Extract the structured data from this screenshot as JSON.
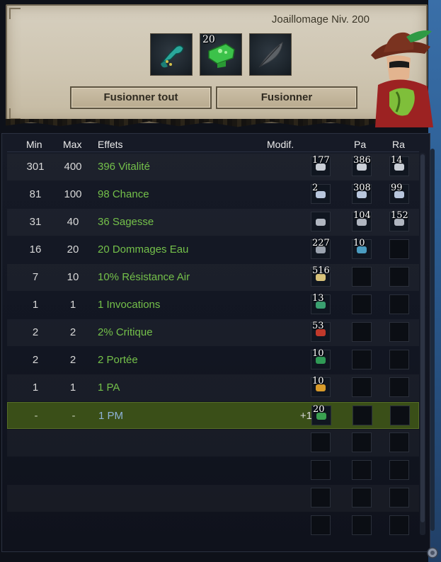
{
  "window": {
    "job_title": "Joaillomage Niv. 200"
  },
  "slots": {
    "rune": {
      "icon": "teal-rune-icon"
    },
    "item": {
      "icon": "green-item-icon",
      "count": "20"
    },
    "feather": {
      "icon": "feather-icon"
    }
  },
  "buttons": {
    "fuse_all": "Fusionner tout",
    "fuse": "Fusionner"
  },
  "table": {
    "headers": {
      "min": "Min",
      "max": "Max",
      "effects": "Effets",
      "modif": "Modif.",
      "pa": "Pa",
      "ra": "Ra"
    },
    "rows": [
      {
        "min": "301",
        "max": "400",
        "effect": "396 Vitalité",
        "modif": "",
        "runes": [
          {
            "count": "177",
            "color": "#c9ced6"
          },
          {
            "count": "386",
            "color": "#c9ced6"
          },
          {
            "count": "14",
            "color": "#c9ced6"
          }
        ]
      },
      {
        "min": "81",
        "max": "100",
        "effect": "98 Chance",
        "modif": "",
        "runes": [
          {
            "count": "2",
            "color": "#b8c6dc"
          },
          {
            "count": "308",
            "color": "#b8c6dc"
          },
          {
            "count": "99",
            "color": "#b8c6dc"
          }
        ]
      },
      {
        "min": "31",
        "max": "40",
        "effect": "36 Sagesse",
        "modif": "",
        "runes": [
          {
            "count": "",
            "color": "#b0b6c0"
          },
          {
            "count": "104",
            "color": "#b0b6c0"
          },
          {
            "count": "152",
            "color": "#b0b6c0"
          }
        ]
      },
      {
        "min": "16",
        "max": "20",
        "effect": "20 Dommages Eau",
        "modif": "",
        "runes": [
          {
            "count": "227",
            "color": "#9aa2ae"
          },
          {
            "count": "10",
            "color": "#4a9cc0"
          },
          null
        ]
      },
      {
        "min": "7",
        "max": "10",
        "effect": "10% Résistance Air",
        "modif": "",
        "runes": [
          {
            "count": "516",
            "color": "#d8c27a"
          },
          null,
          null
        ]
      },
      {
        "min": "1",
        "max": "1",
        "effect": "1 Invocations",
        "modif": "",
        "runes": [
          {
            "count": "13",
            "color": "#3aa070"
          },
          null,
          null
        ]
      },
      {
        "min": "2",
        "max": "2",
        "effect": "2% Critique",
        "modif": "",
        "runes": [
          {
            "count": "53",
            "color": "#c0392b"
          },
          null,
          null
        ]
      },
      {
        "min": "2",
        "max": "2",
        "effect": "2 Portée",
        "modif": "",
        "runes": [
          {
            "count": "10",
            "color": "#2f9a55"
          },
          null,
          null
        ]
      },
      {
        "min": "1",
        "max": "1",
        "effect": "1 PA",
        "modif": "",
        "runes": [
          {
            "count": "10",
            "color": "#d89b2a"
          },
          null,
          null
        ]
      },
      {
        "min": "-",
        "max": "-",
        "effect": "1 PM",
        "modif": "+1",
        "runes": [
          {
            "count": "20",
            "color": "#3aa050"
          },
          null,
          null
        ]
      }
    ],
    "selected_row": 9,
    "empty_rows": 4
  }
}
